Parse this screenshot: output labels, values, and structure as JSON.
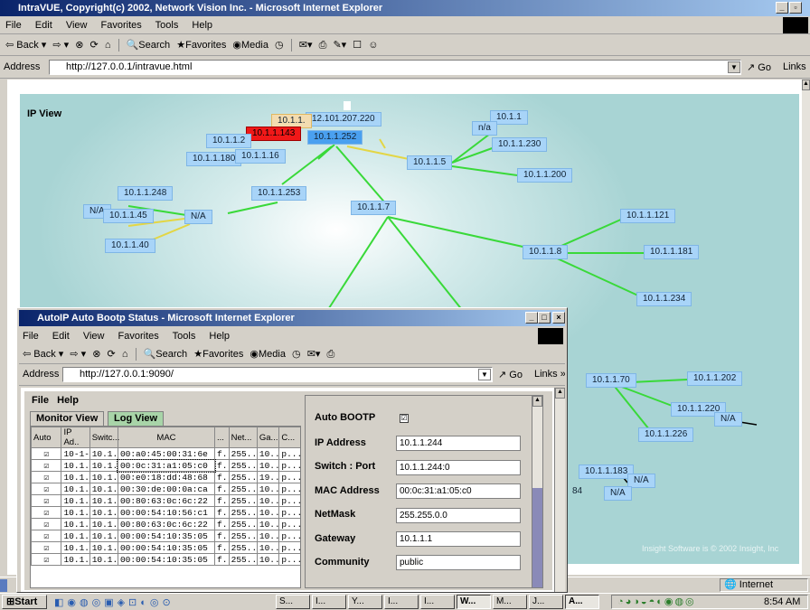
{
  "main_window": {
    "title": "IntraVUE, Copyright(c) 2002, Network Vision Inc. - Microsoft Internet Explorer",
    "menu": [
      "File",
      "Edit",
      "View",
      "Favorites",
      "Tools",
      "Help"
    ],
    "toolbar": {
      "back": "Back",
      "search": "Search",
      "favorites": "Favorites",
      "media": "Media"
    },
    "address_label": "Address",
    "address": "http://127.0.0.1/intravue.html",
    "go": "Go",
    "links": "Links"
  },
  "ip_view": {
    "label": "IP View",
    "copyright": "Insight Software is © 2002 Insight, Inc",
    "nodes": [
      {
        "id": "n1",
        "label": "12.101.207.220"
      },
      {
        "id": "n2",
        "label": "10.1.1."
      },
      {
        "id": "n3",
        "label": "10.1.1.143"
      },
      {
        "id": "n4",
        "label": "10.1.1.252"
      },
      {
        "id": "n5",
        "label": "10.1.1.2"
      },
      {
        "id": "n6",
        "label": "10.1.1.180"
      },
      {
        "id": "n7",
        "label": "10.1.1.16"
      },
      {
        "id": "n8",
        "label": "10.1.1"
      },
      {
        "id": "n9",
        "label": "n/a"
      },
      {
        "id": "n10",
        "label": "10.1.1.230"
      },
      {
        "id": "n11",
        "label": "10.1.1.5"
      },
      {
        "id": "n12",
        "label": "10.1.1.200"
      },
      {
        "id": "n13",
        "label": "10.1.1.248"
      },
      {
        "id": "n14",
        "label": "10.1.1.253"
      },
      {
        "id": "n15",
        "label": "N/A"
      },
      {
        "id": "n16",
        "label": "10.1.1.45"
      },
      {
        "id": "n17",
        "label": "N/A"
      },
      {
        "id": "n18",
        "label": "10.1.1.7"
      },
      {
        "id": "n19",
        "label": "10.1.1.40"
      },
      {
        "id": "n20",
        "label": "10.1.1.121"
      },
      {
        "id": "n21",
        "label": "10.1.1.8"
      },
      {
        "id": "n22",
        "label": "10.1.1.181"
      },
      {
        "id": "n23",
        "label": "10.1.1.234"
      },
      {
        "id": "n24",
        "label": "10.1.1.70"
      },
      {
        "id": "n25",
        "label": "10.1.1.202"
      },
      {
        "id": "n26",
        "label": "10.1.1.220"
      },
      {
        "id": "n27",
        "label": "N/A"
      },
      {
        "id": "n28",
        "label": "10.1.1.226"
      },
      {
        "id": "n29",
        "label": "10.1.1.183"
      },
      {
        "id": "n30",
        "label": "N/A"
      },
      {
        "id": "n31",
        "label": "N/A"
      },
      {
        "id": "n32",
        "label": "84"
      }
    ]
  },
  "popup": {
    "title": "AutoIP Auto Bootp Status - Microsoft Internet Explorer",
    "menu": [
      "File",
      "Edit",
      "View",
      "Favorites",
      "Tools",
      "Help"
    ],
    "address": "http://127.0.0.1:9090/",
    "app_menu": [
      "File",
      "Help"
    ],
    "tabs": [
      "Monitor View",
      "Log View"
    ],
    "columns": [
      "Auto",
      "IP Ad..",
      "Switc...",
      "MAC",
      "...",
      "Net...",
      "Ga...",
      "C..."
    ],
    "rows": [
      [
        "☑",
        "10-1-...",
        "10.1....",
        "00:a0:45:00:31:6e",
        "f...",
        "255....",
        "10....",
        "p..."
      ],
      [
        "☑",
        "10.1....",
        "10.1....",
        "00:0c:31:a1:05:c0",
        "f...",
        "255....",
        "10....",
        "p..."
      ],
      [
        "☑",
        "10.1....",
        "10.1....",
        "00:e0:18:dd:48:68",
        "f...",
        "255....",
        "19....",
        "p..."
      ],
      [
        "☑",
        "10.1....",
        "10.1....",
        "00:30:de:00:0a:ca",
        "f...",
        "255....",
        "10....",
        "p..."
      ],
      [
        "☑",
        "10.1....",
        "10.1....",
        "00:80:63:0c:6c:22",
        "f...",
        "255....",
        "10....",
        "p..."
      ],
      [
        "☑",
        "10.1....",
        "10.1....",
        "00:00:54:10:56:c1",
        "f...",
        "255....",
        "10....",
        "p..."
      ],
      [
        "☑",
        "10.1....",
        "10.1....",
        "00:80:63:0c:6c:22",
        "f...",
        "255....",
        "10....",
        "p..."
      ],
      [
        "☑",
        "10.1....",
        "10.1....",
        "00:00:54:10:35:05",
        "f...",
        "255....",
        "10....",
        "p..."
      ],
      [
        "☑",
        "10.1....",
        "10.1....",
        "00:00:54:10:35:05",
        "f...",
        "255....",
        "10....",
        "p..."
      ],
      [
        "☑",
        "10.1....",
        "10.1....",
        "00:00:54:10:35:05",
        "f...",
        "255....",
        "10....",
        "p..."
      ]
    ],
    "details": {
      "auto_bootp_label": "Auto BOOTP",
      "auto_bootp_value": "☑",
      "ip_label": "IP Address",
      "ip": "10.1.1.244",
      "switch_label": "Switch : Port",
      "switch": "10.1.1.244:0",
      "mac_label": "MAC Address",
      "mac": "00:0c:31:a1:05:c0",
      "netmask_label": "NetMask",
      "netmask": "255.255.0.0",
      "gateway_label": "Gateway",
      "gateway": "10.1.1.1",
      "community_label": "Community",
      "community": "public"
    }
  },
  "status_bar": {
    "zone": "Internet"
  },
  "taskbar": {
    "start": "Start",
    "tasks": [
      "S...",
      "I...",
      "Y...",
      "I...",
      "I...",
      "W...",
      "M...",
      "J...",
      "A..."
    ],
    "clock": "8:54 AM"
  }
}
